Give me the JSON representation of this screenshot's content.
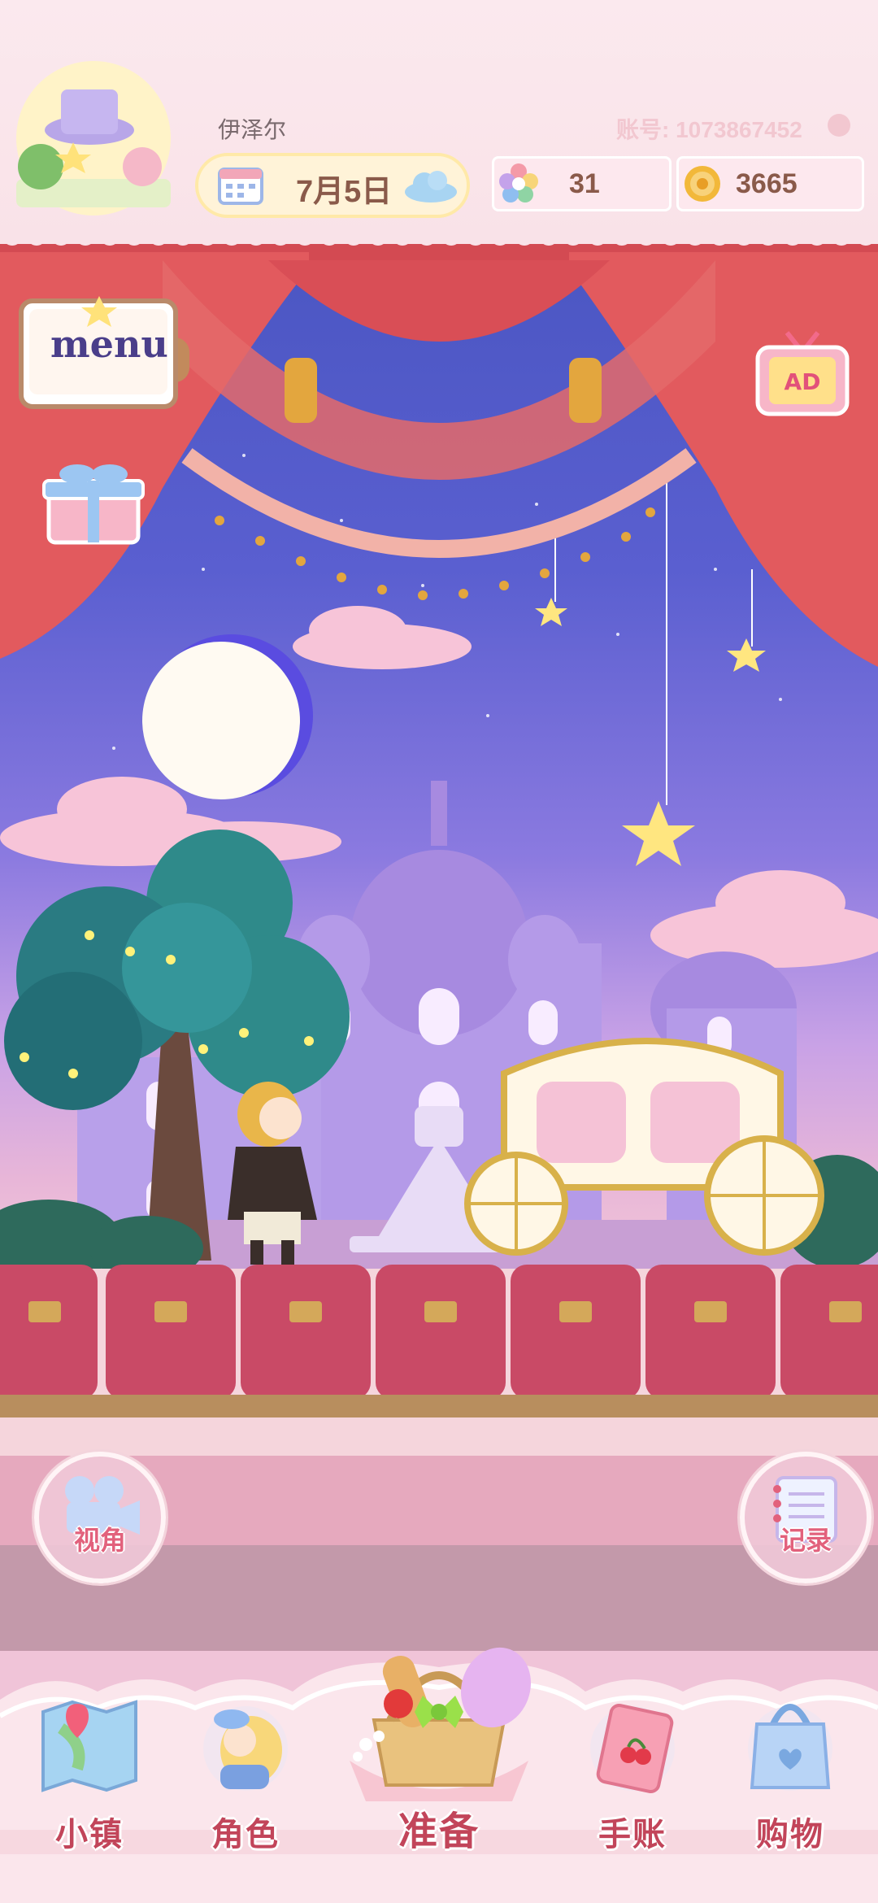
{
  "player": {
    "name": "伊泽尔",
    "account": "账号: 1073867452"
  },
  "date": {
    "text": "7月5日",
    "weather_icon": "cloud-icon"
  },
  "currency": {
    "gems": "31",
    "coins": "3665"
  },
  "menu_button": {
    "label": "menu"
  },
  "ad_button": {
    "label": "AD"
  },
  "side_buttons": {
    "camera": "视角",
    "records": "记录"
  },
  "nav": {
    "items": [
      {
        "label": "小镇",
        "icon": "map-icon"
      },
      {
        "label": "角色",
        "icon": "character-icon"
      },
      {
        "label": "准备",
        "icon": "picnic-basket-icon"
      },
      {
        "label": "手账",
        "icon": "journal-icon"
      },
      {
        "label": "购物",
        "icon": "shopping-bag-icon"
      }
    ]
  },
  "colors": {
    "accent": "#c2455a",
    "curtain": "#e25a5e",
    "pink_bg": "#fbe9ee"
  }
}
